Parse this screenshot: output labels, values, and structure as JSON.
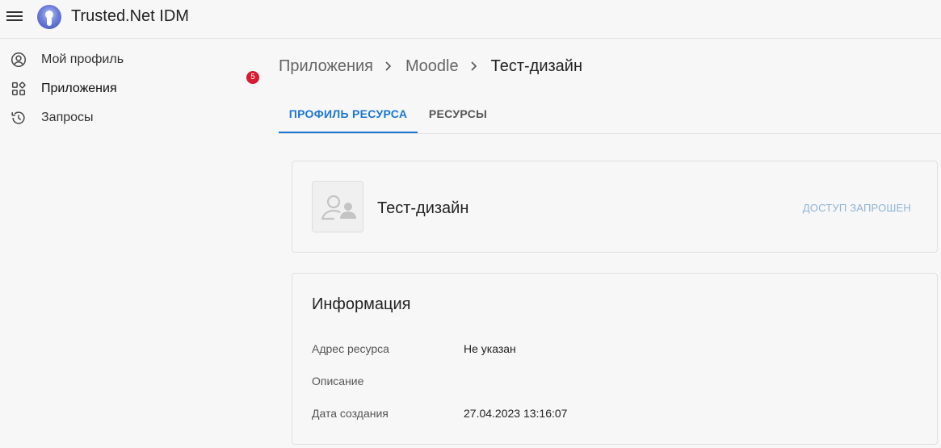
{
  "header": {
    "app_title": "Trusted.Net IDM",
    "icons": {
      "menu": "hamburger-menu-icon",
      "logo": "trusted-net-logo"
    }
  },
  "sidebar": {
    "items": [
      {
        "label": "Мой профиль",
        "icon": "account-circle-icon"
      },
      {
        "label": "Приложения",
        "icon": "apps-grid-icon"
      },
      {
        "label": "Запросы",
        "icon": "history-icon",
        "badge": "5"
      }
    ]
  },
  "breadcrumb": {
    "items": [
      "Приложения",
      "Moodle",
      "Тест-дизайн"
    ]
  },
  "tabs": [
    {
      "label": "ПРОФИЛЬ РЕСУРСА",
      "active": true
    },
    {
      "label": "РЕСУРСЫ",
      "active": false
    }
  ],
  "resource": {
    "name": "Тест-дизайн",
    "status": "ДОСТУП ЗАПРОШЕН",
    "avatar_icon": "resource-placeholder-icon"
  },
  "info": {
    "title": "Информация",
    "rows": [
      {
        "label": "Адрес ресурса",
        "value": "Не указан"
      },
      {
        "label": "Описание",
        "value": ""
      },
      {
        "label": "Дата создания",
        "value": "27.04.2023 13:16:07"
      }
    ]
  },
  "colors": {
    "accent": "#1976d2",
    "badge": "#d81b30",
    "status": "#8fb3d8",
    "background": "#f7f7f7"
  }
}
